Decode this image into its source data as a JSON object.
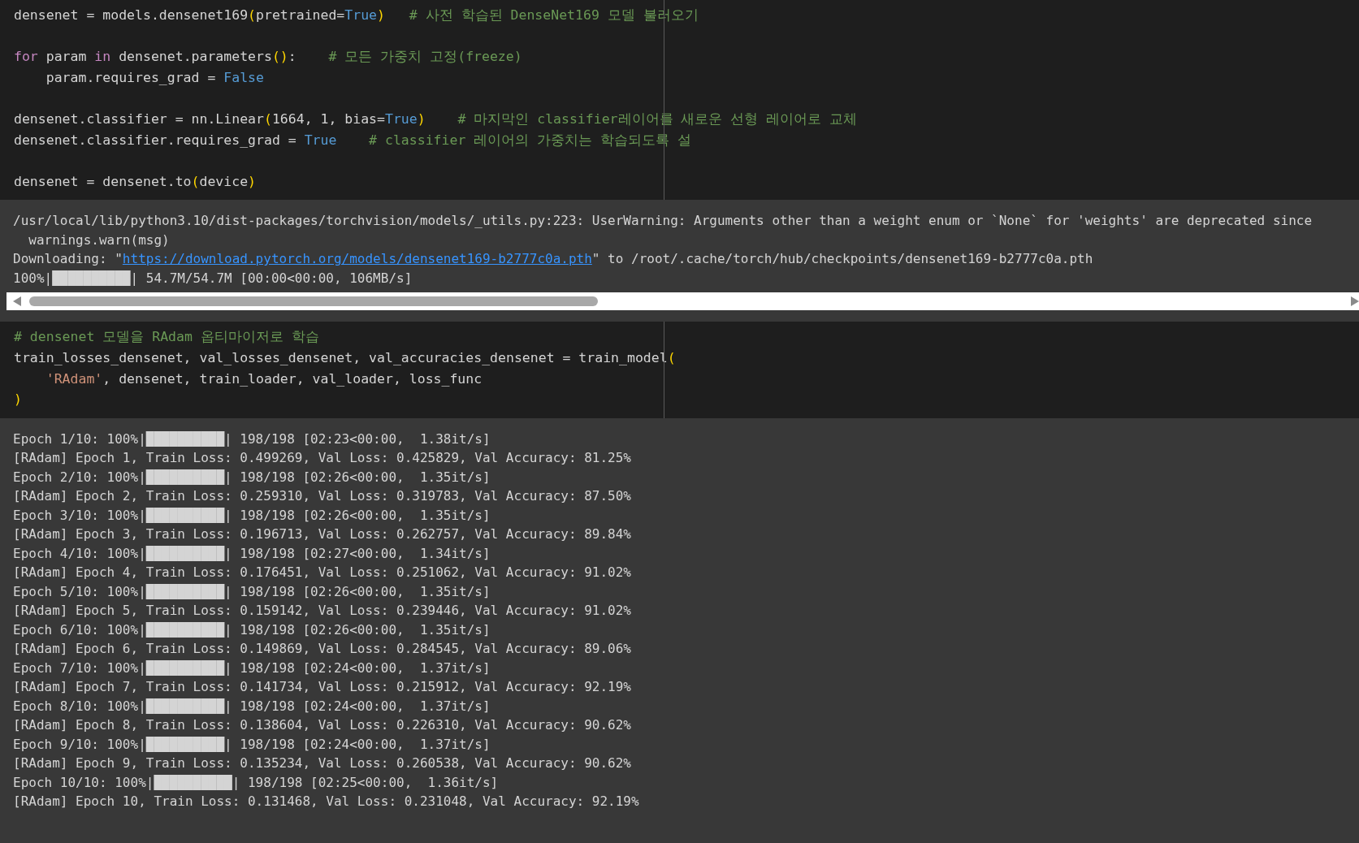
{
  "cells": [
    {
      "kind": "code",
      "lines": [
        {
          "kind": "code",
          "tokens": [
            {
              "kind": "text",
              "text": "densenet = models.densenet169"
            },
            {
              "kind": "paren",
              "text": "("
            },
            {
              "kind": "text",
              "text": "pretrained="
            },
            {
              "kind": "const",
              "text": "True"
            },
            {
              "kind": "paren",
              "text": ")"
            },
            {
              "kind": "comment",
              "text": "   # 사전 학습된 DenseNet169 모델 불러오기"
            }
          ]
        },
        {
          "kind": "blank"
        },
        {
          "kind": "code",
          "tokens": [
            {
              "kind": "kw",
              "text": "for"
            },
            {
              "kind": "text",
              "text": " param "
            },
            {
              "kind": "kw",
              "text": "in"
            },
            {
              "kind": "text",
              "text": " densenet.parameters"
            },
            {
              "kind": "paren",
              "text": "()"
            },
            {
              "kind": "text",
              "text": ":    "
            },
            {
              "kind": "comment",
              "text": "# 모든 가중치 고정(freeze)"
            }
          ]
        },
        {
          "kind": "code",
          "tokens": [
            {
              "kind": "text",
              "text": "    param.requires_grad = "
            },
            {
              "kind": "const",
              "text": "False"
            }
          ]
        },
        {
          "kind": "blank"
        },
        {
          "kind": "code",
          "tokens": [
            {
              "kind": "text",
              "text": "densenet.classifier = nn.Linear"
            },
            {
              "kind": "paren",
              "text": "("
            },
            {
              "kind": "text",
              "text": "1664, 1, bias="
            },
            {
              "kind": "const",
              "text": "True"
            },
            {
              "kind": "paren",
              "text": ")"
            },
            {
              "kind": "comment",
              "text": "    # 마지막인 classifier레이어를 새로운 선형 레이어로 교체"
            }
          ]
        },
        {
          "kind": "code",
          "tokens": [
            {
              "kind": "text",
              "text": "densenet.classifier.requires_grad = "
            },
            {
              "kind": "const",
              "text": "True"
            },
            {
              "kind": "comment",
              "text": "    # classifier 레이어의 가중치는 학습되도록 설"
            }
          ]
        },
        {
          "kind": "blank"
        },
        {
          "kind": "code",
          "tokens": [
            {
              "kind": "text",
              "text": "densenet = densenet.to"
            },
            {
              "kind": "paren",
              "text": "("
            },
            {
              "kind": "text",
              "text": "device"
            },
            {
              "kind": "paren",
              "text": ")"
            }
          ]
        }
      ]
    },
    {
      "kind": "output",
      "scrollbar": true,
      "lines": [
        {
          "kind": "code",
          "tokens": [
            {
              "kind": "text",
              "text": "/usr/local/lib/python3.10/dist-packages/torchvision/models/_utils.py:223: UserWarning: Arguments other than a weight enum or `None` for 'weights' are deprecated since"
            }
          ]
        },
        {
          "kind": "code",
          "tokens": [
            {
              "kind": "text",
              "text": "  warnings.warn(msg)"
            }
          ]
        },
        {
          "kind": "code",
          "tokens": [
            {
              "kind": "text",
              "text": "Downloading: \""
            },
            {
              "kind": "link",
              "text": "https://download.pytorch.org/models/densenet169-b2777c0a.pth"
            },
            {
              "kind": "text",
              "text": "\" to /root/.cache/torch/hub/checkpoints/densenet169-b2777c0a.pth"
            }
          ]
        },
        {
          "kind": "code",
          "tokens": [
            {
              "kind": "text",
              "text": "100%|██████████| 54.7M/54.7M [00:00<00:00, 106MB/s]"
            }
          ]
        }
      ]
    },
    {
      "kind": "code",
      "lines": [
        {
          "kind": "code",
          "tokens": [
            {
              "kind": "comment",
              "text": "# densenet 모델을 RAdam 옵티마이저로 학습"
            }
          ]
        },
        {
          "kind": "code",
          "tokens": [
            {
              "kind": "text",
              "text": "train_losses_densenet, val_losses_densenet, val_accuracies_densenet = train_model"
            },
            {
              "kind": "paren",
              "text": "("
            }
          ]
        },
        {
          "kind": "code",
          "indented": true,
          "tokens": [
            {
              "kind": "string",
              "text": "'RAdam'"
            },
            {
              "kind": "text",
              "text": ", densenet, train_loader, val_loader, loss_func"
            }
          ]
        },
        {
          "kind": "code",
          "tokens": [
            {
              "kind": "paren",
              "text": ")"
            }
          ]
        }
      ]
    },
    {
      "kind": "output",
      "scrollbar": false,
      "lines": [
        {
          "kind": "code",
          "tokens": [
            {
              "kind": "text",
              "text": "Epoch 1/10: 100%|██████████| 198/198 [02:23<00:00,  1.38it/s]"
            }
          ]
        },
        {
          "kind": "code",
          "tokens": [
            {
              "kind": "text",
              "text": "[RAdam] Epoch 1, Train Loss: 0.499269, Val Loss: 0.425829, Val Accuracy: 81.25%"
            }
          ]
        },
        {
          "kind": "code",
          "tokens": [
            {
              "kind": "text",
              "text": "Epoch 2/10: 100%|██████████| 198/198 [02:26<00:00,  1.35it/s]"
            }
          ]
        },
        {
          "kind": "code",
          "tokens": [
            {
              "kind": "text",
              "text": "[RAdam] Epoch 2, Train Loss: 0.259310, Val Loss: 0.319783, Val Accuracy: 87.50%"
            }
          ]
        },
        {
          "kind": "code",
          "tokens": [
            {
              "kind": "text",
              "text": "Epoch 3/10: 100%|██████████| 198/198 [02:26<00:00,  1.35it/s]"
            }
          ]
        },
        {
          "kind": "code",
          "tokens": [
            {
              "kind": "text",
              "text": "[RAdam] Epoch 3, Train Loss: 0.196713, Val Loss: 0.262757, Val Accuracy: 89.84%"
            }
          ]
        },
        {
          "kind": "code",
          "tokens": [
            {
              "kind": "text",
              "text": "Epoch 4/10: 100%|██████████| 198/198 [02:27<00:00,  1.34it/s]"
            }
          ]
        },
        {
          "kind": "code",
          "tokens": [
            {
              "kind": "text",
              "text": "[RAdam] Epoch 4, Train Loss: 0.176451, Val Loss: 0.251062, Val Accuracy: 91.02%"
            }
          ]
        },
        {
          "kind": "code",
          "tokens": [
            {
              "kind": "text",
              "text": "Epoch 5/10: 100%|██████████| 198/198 [02:26<00:00,  1.35it/s]"
            }
          ]
        },
        {
          "kind": "code",
          "tokens": [
            {
              "kind": "text",
              "text": "[RAdam] Epoch 5, Train Loss: 0.159142, Val Loss: 0.239446, Val Accuracy: 91.02%"
            }
          ]
        },
        {
          "kind": "code",
          "tokens": [
            {
              "kind": "text",
              "text": "Epoch 6/10: 100%|██████████| 198/198 [02:26<00:00,  1.35it/s]"
            }
          ]
        },
        {
          "kind": "code",
          "tokens": [
            {
              "kind": "text",
              "text": "[RAdam] Epoch 6, Train Loss: 0.149869, Val Loss: 0.284545, Val Accuracy: 89.06%"
            }
          ]
        },
        {
          "kind": "code",
          "tokens": [
            {
              "kind": "text",
              "text": "Epoch 7/10: 100%|██████████| 198/198 [02:24<00:00,  1.37it/s]"
            }
          ]
        },
        {
          "kind": "code",
          "tokens": [
            {
              "kind": "text",
              "text": "[RAdam] Epoch 7, Train Loss: 0.141734, Val Loss: 0.215912, Val Accuracy: 92.19%"
            }
          ]
        },
        {
          "kind": "code",
          "tokens": [
            {
              "kind": "text",
              "text": "Epoch 8/10: 100%|██████████| 198/198 [02:24<00:00,  1.37it/s]"
            }
          ]
        },
        {
          "kind": "code",
          "tokens": [
            {
              "kind": "text",
              "text": "[RAdam] Epoch 8, Train Loss: 0.138604, Val Loss: 0.226310, Val Accuracy: 90.62%"
            }
          ]
        },
        {
          "kind": "code",
          "tokens": [
            {
              "kind": "text",
              "text": "Epoch 9/10: 100%|██████████| 198/198 [02:24<00:00,  1.37it/s]"
            }
          ]
        },
        {
          "kind": "code",
          "tokens": [
            {
              "kind": "text",
              "text": "[RAdam] Epoch 9, Train Loss: 0.135234, Val Loss: 0.260538, Val Accuracy: 90.62%"
            }
          ]
        },
        {
          "kind": "code",
          "tokens": [
            {
              "kind": "text",
              "text": "Epoch 10/10: 100%|██████████| 198/198 [02:25<00:00,  1.36it/s]"
            }
          ]
        },
        {
          "kind": "code",
          "tokens": [
            {
              "kind": "text",
              "text": "[RAdam] Epoch 10, Train Loss: 0.131468, Val Loss: 0.231048, Val Accuracy: 92.19%"
            }
          ]
        }
      ]
    }
  ]
}
